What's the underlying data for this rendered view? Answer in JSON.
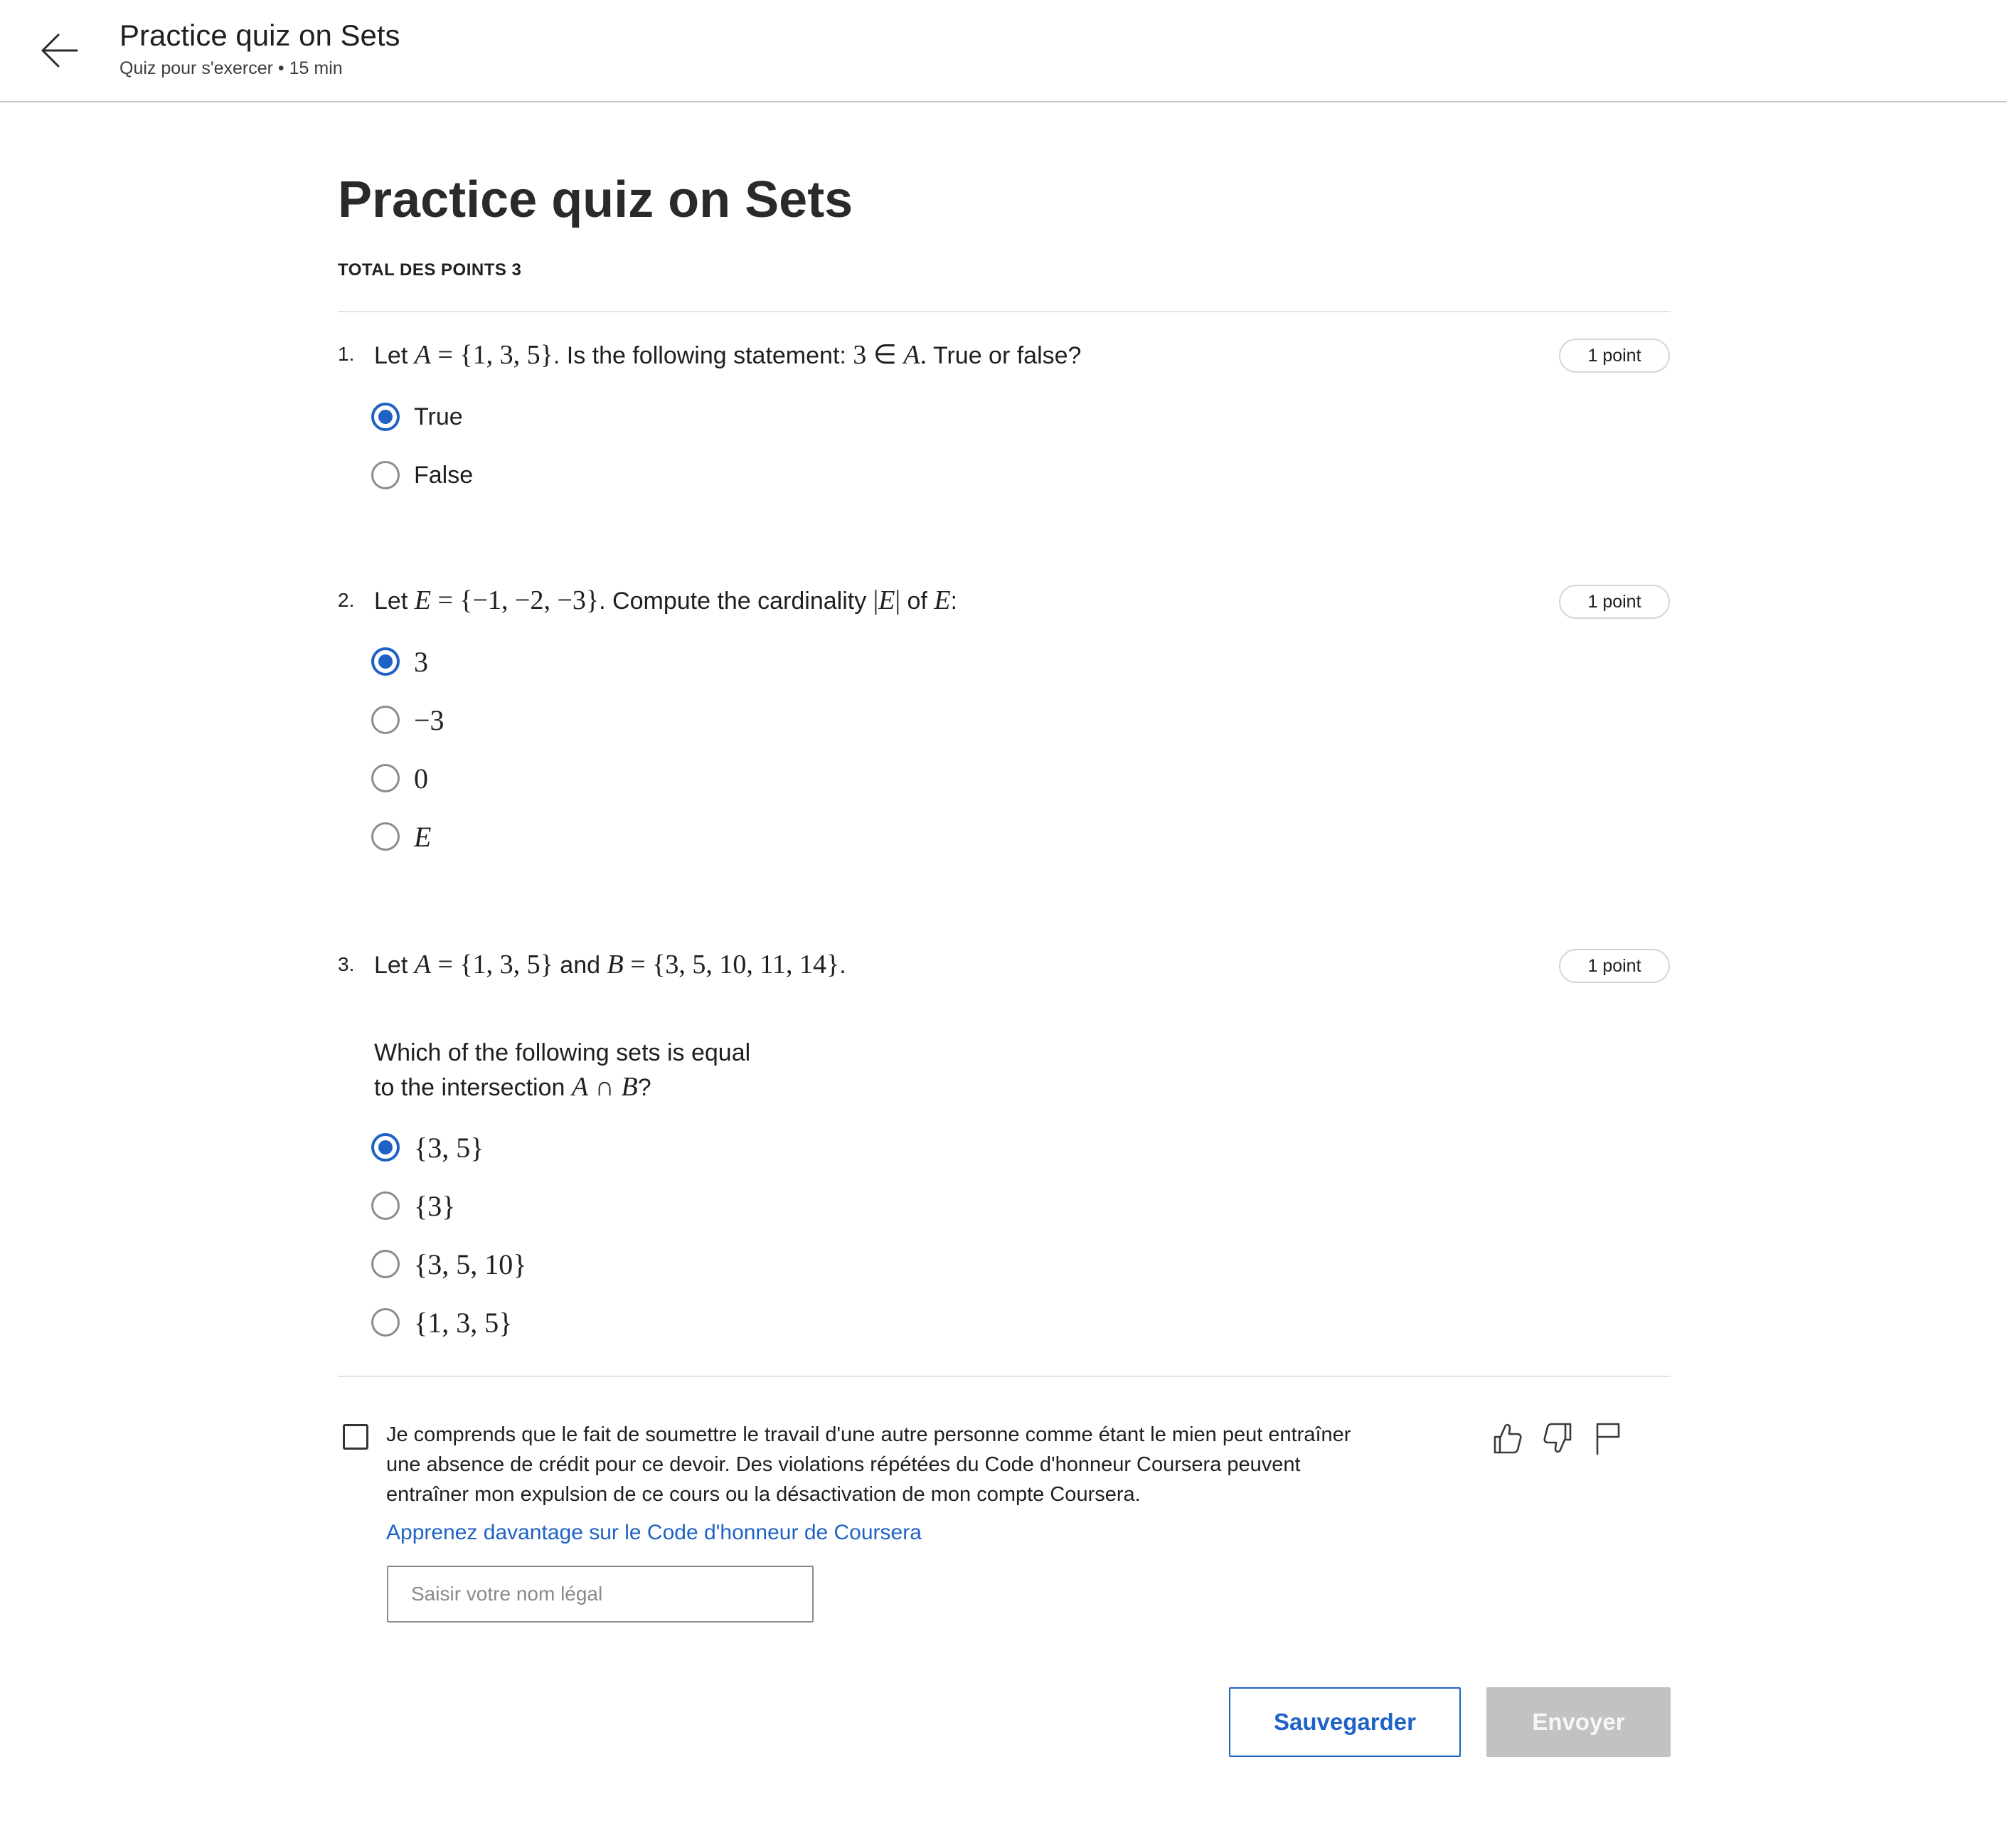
{
  "header": {
    "title": "Practice quiz on Sets",
    "subtitle": "Quiz pour s'exercer • 15 min",
    "back_icon": "arrow-left-icon"
  },
  "quiz": {
    "title": "Practice quiz on Sets",
    "total_points": "TOTAL DES POINTS 3",
    "questions": [
      {
        "number": "1.",
        "points": "1 point",
        "text": {
          "t1": "Let ",
          "a1": "A",
          "m1": " = {1, 3, 5}",
          "t2": ". Is the following statement:  ",
          "m2": "3 ∈ ",
          "a2": "A",
          "m3": ".",
          "t3": "  True or false?"
        },
        "options": [
          {
            "label": "True",
            "selected": true
          },
          {
            "label": "False",
            "selected": false
          }
        ]
      },
      {
        "number": "2.",
        "points": "1 point",
        "text": {
          "t1": "Let ",
          "e1": "E",
          "m1": " = {−1, −2, −3}",
          "t2": ". Compute the cardinality ",
          "m2": "|",
          "e2": "E",
          "m3": "|",
          "t3": " of ",
          "e3": "E",
          "t4": ":"
        },
        "options": [
          {
            "label": "3",
            "selected": true
          },
          {
            "label": "−3",
            "selected": false
          },
          {
            "label": "0",
            "selected": false
          },
          {
            "label": "E",
            "selected": false
          }
        ]
      },
      {
        "number": "3.",
        "points": "1 point",
        "text": {
          "t1": "Let ",
          "a1": "A",
          "m1": " = {1, 3, 5}",
          "t2": " and ",
          "b1": "B",
          "m2": " = {3, 5, 10, 11, 14}",
          "t3": "."
        },
        "subtext": {
          "line1": "Which of the following sets is equal",
          "line2_t": "to the intersection ",
          "line2_a": "A",
          "line2_op": " ∩ ",
          "line2_b": "B",
          "line2_end": "?"
        },
        "options": [
          {
            "label": "{3, 5}",
            "selected": true
          },
          {
            "label": "{3}",
            "selected": false
          },
          {
            "label": "{3, 5, 10}",
            "selected": false
          },
          {
            "label": "{1, 3, 5}",
            "selected": false
          }
        ]
      }
    ]
  },
  "honor": {
    "text": "Je comprends que le fait de soumettre le travail d'une autre personne comme étant le mien peut entraîner une absence de crédit pour ce devoir. Des violations répétées du Code d'honneur Coursera peuvent entraîner mon expulsion de ce cours ou la désactivation de mon compte Coursera.",
    "link": "Apprenez davantage sur le Code d'honneur de Coursera",
    "name_placeholder": "Saisir votre nom légal",
    "name_value": "",
    "checked": false
  },
  "feedback_icons": [
    "thumbs-up-icon",
    "thumbs-down-icon",
    "flag-icon"
  ],
  "actions": {
    "save": "Sauvegarder",
    "submit": "Envoyer"
  },
  "colors": {
    "accent": "#1f62c6",
    "disabled_button": "#c2c2c2",
    "text": "#1f1f1f"
  }
}
